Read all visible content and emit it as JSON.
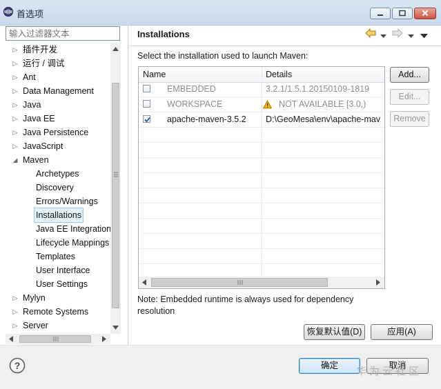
{
  "window": {
    "title": "首选项"
  },
  "left": {
    "filter_placeholder": "输入过滤器文本",
    "tree": [
      {
        "label": "插件开发",
        "level": 0,
        "state": "collapsed"
      },
      {
        "label": "运行 / 调试",
        "level": 0,
        "state": "collapsed"
      },
      {
        "label": "Ant",
        "level": 0,
        "state": "collapsed"
      },
      {
        "label": "Data Management",
        "level": 0,
        "state": "collapsed"
      },
      {
        "label": "Java",
        "level": 0,
        "state": "collapsed"
      },
      {
        "label": "Java EE",
        "level": 0,
        "state": "collapsed"
      },
      {
        "label": "Java Persistence",
        "level": 0,
        "state": "collapsed"
      },
      {
        "label": "JavaScript",
        "level": 0,
        "state": "collapsed"
      },
      {
        "label": "Maven",
        "level": 0,
        "state": "expanded"
      },
      {
        "label": "Archetypes",
        "level": 1
      },
      {
        "label": "Discovery",
        "level": 1
      },
      {
        "label": "Errors/Warnings",
        "level": 1
      },
      {
        "label": "Installations",
        "level": 1,
        "selected": true
      },
      {
        "label": "Java EE Integration",
        "level": 1
      },
      {
        "label": "Lifecycle Mappings",
        "level": 1
      },
      {
        "label": "Templates",
        "level": 1
      },
      {
        "label": "User Interface",
        "level": 1
      },
      {
        "label": "User Settings",
        "level": 1
      },
      {
        "label": "Mylyn",
        "level": 0,
        "state": "collapsed"
      },
      {
        "label": "Remote Systems",
        "level": 0,
        "state": "collapsed"
      },
      {
        "label": "Server",
        "level": 0,
        "state": "collapsed"
      }
    ]
  },
  "right": {
    "title": "Installations",
    "instruction": "Select the installation used to launch Maven:",
    "columns": {
      "name": "Name",
      "details": "Details"
    },
    "rows": [
      {
        "checked": false,
        "name": "EMBEDDED",
        "details": "3.2.1/1.5.1.20150109-1819",
        "muted": true,
        "warning": false
      },
      {
        "checked": false,
        "name": "WORKSPACE",
        "details": "NOT AVAILABLE [3.0,)",
        "muted": true,
        "warning": true
      },
      {
        "checked": true,
        "name": "apache-maven-3.5.2",
        "details": "D:\\GeoMesa\\env\\apache-mav",
        "muted": false,
        "warning": false
      }
    ],
    "buttons": {
      "add": "Add...",
      "edit": "Edit...",
      "remove": "Remove"
    },
    "note": "Note: Embedded runtime is always used for dependency resolution",
    "restore_defaults": "恢复默认值(D)",
    "apply": "应用(A)"
  },
  "footer": {
    "ok": "确定",
    "cancel": "取消",
    "watermark": "华为云社区"
  },
  "colors": {
    "titlebar": "#c9d9ec",
    "selection": "#e5f1fb",
    "warning": "#f2b400",
    "primary_border": "#2a7fc4"
  }
}
